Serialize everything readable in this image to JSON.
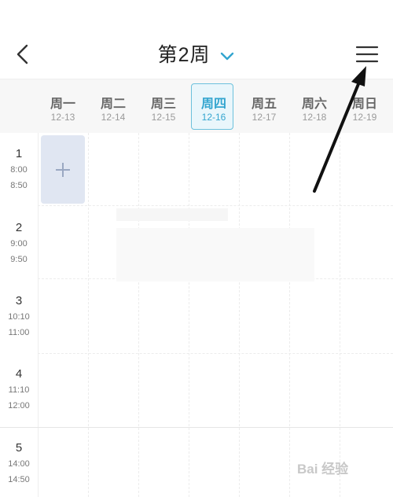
{
  "header": {
    "title": "第2周",
    "back_icon": "chevron-left-icon",
    "dropdown_icon": "chevron-down-icon",
    "menu_icon": "hamburger-menu-icon",
    "accent_color": "#33a5cf"
  },
  "week": {
    "days": [
      {
        "name": "周一",
        "date": "12-13"
      },
      {
        "name": "周二",
        "date": "12-14"
      },
      {
        "name": "周三",
        "date": "12-15"
      },
      {
        "name": "周四",
        "date": "12-16"
      },
      {
        "name": "周五",
        "date": "12-17"
      },
      {
        "name": "周六",
        "date": "12-18"
      },
      {
        "name": "周日",
        "date": "12-19"
      }
    ],
    "active_index": 3
  },
  "periods": [
    {
      "num": "1",
      "start": "8:00",
      "end": "8:50"
    },
    {
      "num": "2",
      "start": "9:00",
      "end": "9:50"
    },
    {
      "num": "3",
      "start": "10:10",
      "end": "11:00"
    },
    {
      "num": "4",
      "start": "11:10",
      "end": "12:00"
    },
    {
      "num": "5",
      "start": "14:00",
      "end": "14:50"
    }
  ],
  "add_cell": {
    "icon": "plus-icon"
  },
  "watermark": "Bai 经验"
}
